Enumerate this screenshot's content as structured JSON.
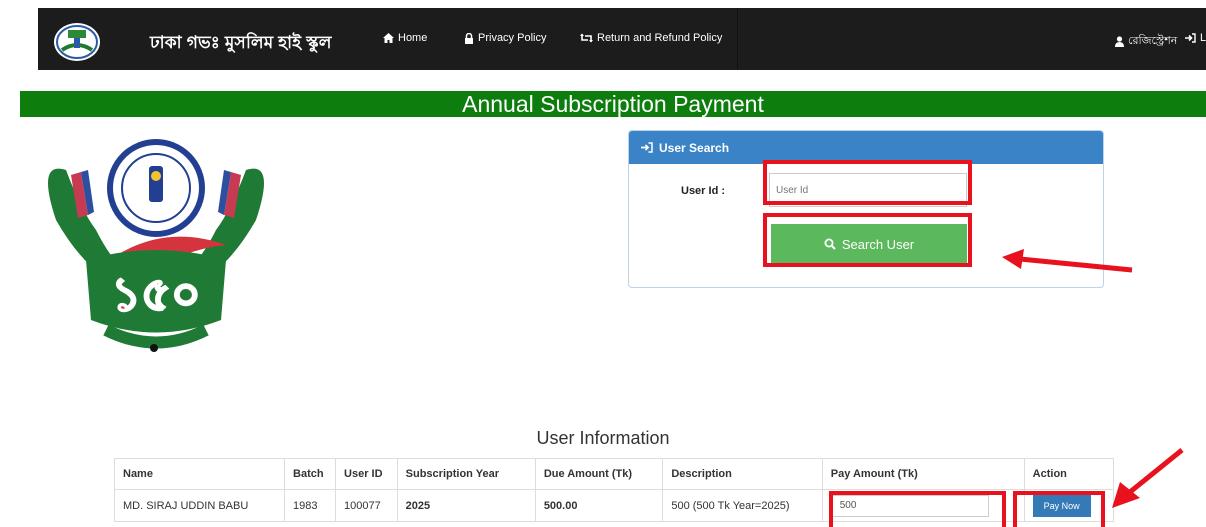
{
  "navbar": {
    "brand": "ঢাকা গভঃ মুসলিম হাই স্কুল",
    "items": [
      {
        "label": "Home",
        "icon": "home-icon"
      },
      {
        "label": "Privacy Policy",
        "icon": "lock-icon"
      },
      {
        "label": "Return and Refund Policy",
        "icon": "retweet-icon"
      }
    ],
    "right": [
      {
        "label": "রেজিস্ট্রেশন",
        "icon": "user-icon"
      },
      {
        "label": "Lo",
        "icon": "login-icon"
      }
    ]
  },
  "banner": {
    "title": "Annual Subscription Payment"
  },
  "search_panel": {
    "heading": "User Search",
    "user_id_label": "User Id :",
    "user_id_placeholder": "User Id",
    "search_button": "Search User"
  },
  "user_info": {
    "title": "User Information",
    "columns": [
      "Name",
      "Batch",
      "User ID",
      "Subscription Year",
      "Due Amount (Tk)",
      "Description",
      "Pay Amount (Tk)",
      "Action"
    ],
    "rows": [
      {
        "name": "MD. SIRAJ UDDIN BABU",
        "batch": "1983",
        "user_id": "100077",
        "subscription_year": "2025",
        "due_amount": "500.00",
        "description": "500 (500 Tk Year=2025)",
        "pay_amount": "500",
        "action": "Pay Now"
      }
    ]
  },
  "colors": {
    "navbar": "#1c1c1c",
    "banner": "#0d7d0d",
    "panel_header": "#3a83c6",
    "search_button": "#5cb85c",
    "pay_button": "#337ab7",
    "highlight": "#e8121e"
  }
}
